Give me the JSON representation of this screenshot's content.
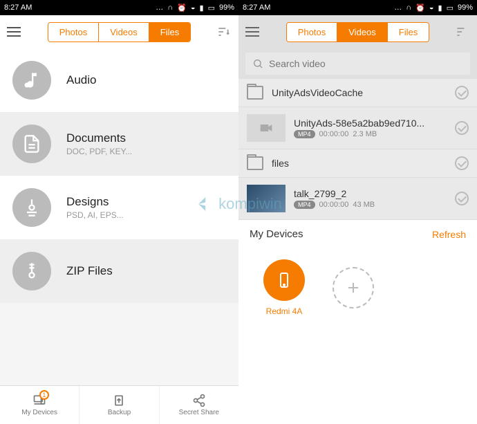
{
  "statusbar": {
    "time": "8:27 AM",
    "battery": "99%"
  },
  "tabs": {
    "photos": "Photos",
    "videos": "Videos",
    "files": "Files"
  },
  "left": {
    "categories": [
      {
        "title": "Audio",
        "sub": ""
      },
      {
        "title": "Documents",
        "sub": "DOC, PDF, KEY..."
      },
      {
        "title": "Designs",
        "sub": "PSD, AI, EPS..."
      },
      {
        "title": "ZIP Files",
        "sub": ""
      }
    ],
    "nav": {
      "mydevices": "My Devices",
      "badge": "1",
      "backup": "Backup",
      "secret": "Secret Share"
    }
  },
  "right": {
    "search_placeholder": "Search video",
    "items": {
      "folder1": "UnityAdsVideoCache",
      "video1": {
        "name": "UnityAds-58e5a2bab9ed710...",
        "duration": "00:00:00",
        "size": "2.3 MB",
        "badge": "MP4"
      },
      "folder2": "files",
      "video2": {
        "name": "talk_2799_2",
        "duration": "00:00:00",
        "size": "43 MB",
        "badge": "MP4"
      }
    },
    "panel": {
      "title": "My Devices",
      "refresh": "Refresh",
      "device": "Redmi 4A"
    }
  },
  "watermark": "kompiwin"
}
